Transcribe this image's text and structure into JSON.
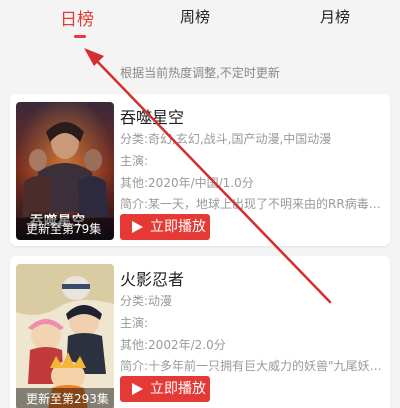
{
  "tabs": [
    {
      "label": "日榜",
      "active": true
    },
    {
      "label": "周榜",
      "active": false
    },
    {
      "label": "月榜",
      "active": false
    }
  ],
  "subtitle": "根据当前热度调整,不定时更新",
  "items": [
    {
      "title": "吞噬星空",
      "category": "分类:奇幻,玄幻,战斗,国产动漫,中国动漫",
      "cast": "主演:",
      "other": "其他:2020年/中国/1.0分",
      "intro": "简介:某一天，地球上出现了不明来由的RR病毒，将...",
      "poster_caption": "更新至第79集",
      "poster_art_text": "吞噬星空",
      "play_label": "立即播放"
    },
    {
      "title": "火影忍者",
      "category": "分类:动漫",
      "cast": "主演:",
      "other": "其他:2002年/2.0分",
      "intro": "简介:十多年前一只拥有巨大威力的妖兽\"九尾妖狐\"...",
      "poster_caption": "更新至第293集",
      "play_label": "立即播放"
    }
  ],
  "colors": {
    "accent": "#e53935",
    "annotation_arrow": "#d32f2f"
  },
  "icons": {
    "play": "play-icon"
  }
}
